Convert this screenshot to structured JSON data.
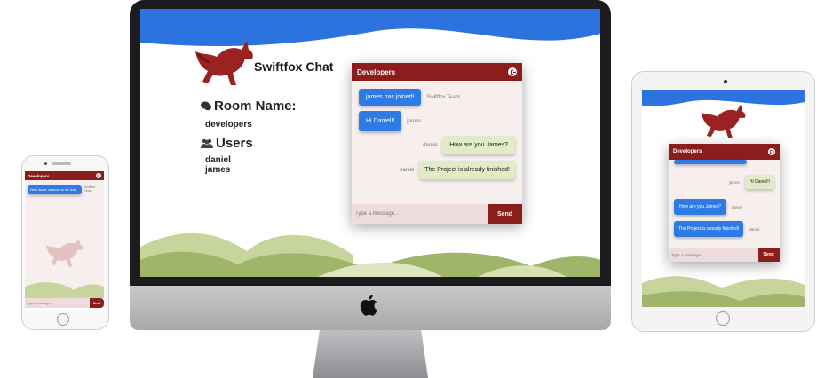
{
  "desktop": {
    "app_title": "Swiftfox Chat",
    "room_label": "Room Name:",
    "room_name": "developers",
    "users_label": "Users",
    "users": [
      "daniel",
      "james"
    ],
    "chat": {
      "header": "Developers",
      "messages": [
        {
          "text": "james has joined!",
          "sender": "Swiftfox Team",
          "style": "blue"
        },
        {
          "text": "Hi Daniel!!",
          "sender": "james",
          "style": "blue"
        },
        {
          "text": "How are you James?",
          "sender": "daniel",
          "style": "green"
        },
        {
          "text": "The Project is already finished!",
          "sender": "daniel",
          "style": "green"
        }
      ],
      "input_placeholder": "Type a message...",
      "send_label": "Send"
    }
  },
  "tablet": {
    "chat": {
      "header": "Developers",
      "messages": [
        {
          "text": "Hi Daniel!!",
          "sender": "james",
          "style": "green"
        },
        {
          "text": "How are you James?",
          "sender": "daniel",
          "style": "blue"
        },
        {
          "text": "The Project is already finished!",
          "sender": "daniel",
          "style": "blue"
        }
      ],
      "input_placeholder": "Type a message...",
      "send_label": "Send"
    }
  },
  "phone": {
    "chat": {
      "header": "Developers",
      "messages": [
        {
          "text": "Hello daniel, welcome to the chat!",
          "sender": "Swiftfox Team",
          "style": "blue"
        }
      ],
      "input_placeholder": "Type a message...",
      "send_label": "Send"
    }
  },
  "colors": {
    "brand_red": "#8c1d1d",
    "bubble_blue": "#2f7be6",
    "bubble_green": "#e2ebc8",
    "wave_blue": "#2d73e0",
    "hills_green": "#b7c98a"
  },
  "icons": [
    "fox-logo-icon",
    "chat-bubbles-icon",
    "users-icon",
    "leave-chat-icon",
    "apple-logo-icon"
  ]
}
